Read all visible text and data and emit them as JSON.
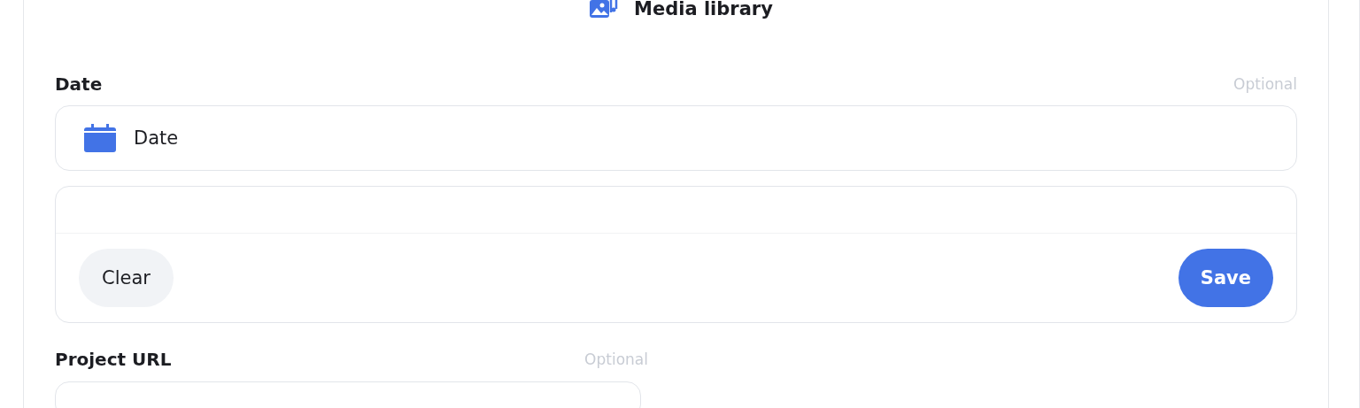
{
  "header": {
    "title": "Media library"
  },
  "date_section": {
    "label": "Date",
    "hint": "Optional",
    "field": {
      "value": "Date"
    },
    "picker": {
      "buttons": [
        {
          "label": "Clear",
          "kind": "secondary"
        },
        {
          "label": "Save",
          "kind": "primary"
        }
      ]
    }
  },
  "project_url": {
    "label": "Project URL",
    "hint": "Optional"
  }
}
